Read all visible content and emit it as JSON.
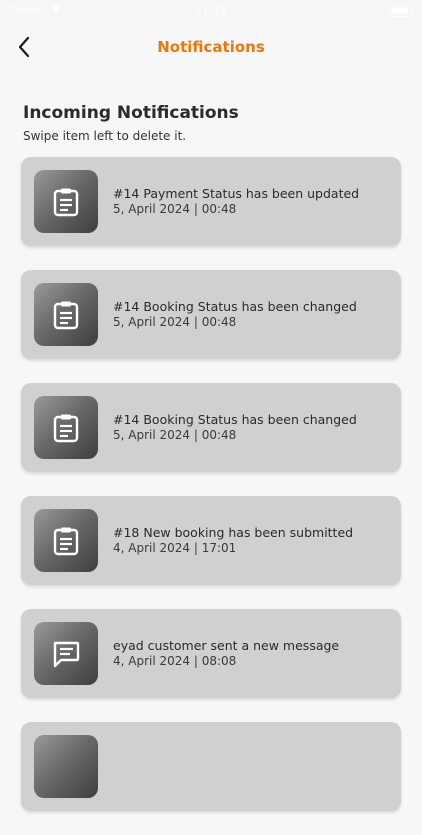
{
  "status_bar": {
    "carrier": "Carrier",
    "time": "11:45"
  },
  "header": {
    "title": "Notifications"
  },
  "section": {
    "title": "Incoming Notifications",
    "subtitle": "Swipe item left to delete it."
  },
  "notifications": [
    {
      "icon": "clipboard-icon",
      "title": "#14 Payment Status has been updated",
      "date": "5, April 2024 | 00:48"
    },
    {
      "icon": "clipboard-icon",
      "title": "#14 Booking Status has been changed",
      "date": "5, April 2024 | 00:48"
    },
    {
      "icon": "clipboard-icon",
      "title": "#14 Booking Status has been changed",
      "date": "5, April 2024 | 00:48"
    },
    {
      "icon": "clipboard-icon",
      "title": "#18 New booking has been submitted",
      "date": "4, April 2024 | 17:01"
    },
    {
      "icon": "message-icon",
      "title": "eyad customer sent a new message",
      "date": "4, April 2024 | 08:08"
    }
  ],
  "colors": {
    "accent": "#e8780e",
    "card": "#d0d0d0",
    "background": "#f7f7f7"
  }
}
